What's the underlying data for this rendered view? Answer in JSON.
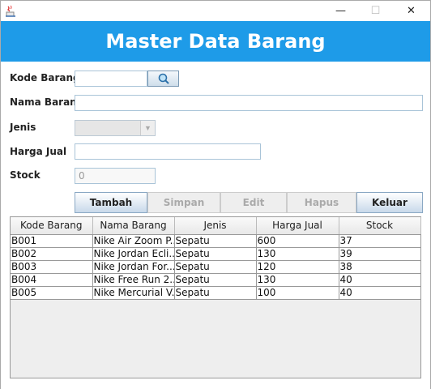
{
  "window": {
    "min_glyph": "—",
    "max_glyph": "☐",
    "close_glyph": "✕"
  },
  "header": {
    "title": "Master Data Barang"
  },
  "form": {
    "kode_label": "Kode Barang",
    "nama_label": "Nama Barang",
    "jenis_label": "Jenis",
    "harga_label": "Harga Jual",
    "stock_label": "Stock",
    "kode_value": "",
    "nama_value": "",
    "harga_value": "",
    "stock_value": "0"
  },
  "buttons": {
    "tambah": "Tambah",
    "simpan": "Simpan",
    "edit": "Edit",
    "hapus": "Hapus",
    "keluar": "Keluar"
  },
  "table": {
    "columns": [
      "Kode Barang",
      "Nama Barang",
      "Jenis",
      "Harga Jual",
      "Stock"
    ],
    "rows": [
      [
        "B001",
        "Nike Air Zoom P...",
        "Sepatu",
        "600",
        "37"
      ],
      [
        "B002",
        "Nike Jordan Ecli...",
        "Sepatu",
        "130",
        "39"
      ],
      [
        "B003",
        "Nike Jordan For...",
        "Sepatu",
        "120",
        "38"
      ],
      [
        "B004",
        "Nike Free Run 2...",
        "Sepatu",
        "130",
        "40"
      ],
      [
        "B005",
        "Nike Mercurial V...",
        "Sepatu",
        "100",
        "40"
      ]
    ]
  },
  "colors": {
    "header_bg": "#1e9be8",
    "header_text": "#ffffff"
  },
  "icons": {
    "app": "java-app-icon",
    "lookup": "magnifier-icon"
  }
}
